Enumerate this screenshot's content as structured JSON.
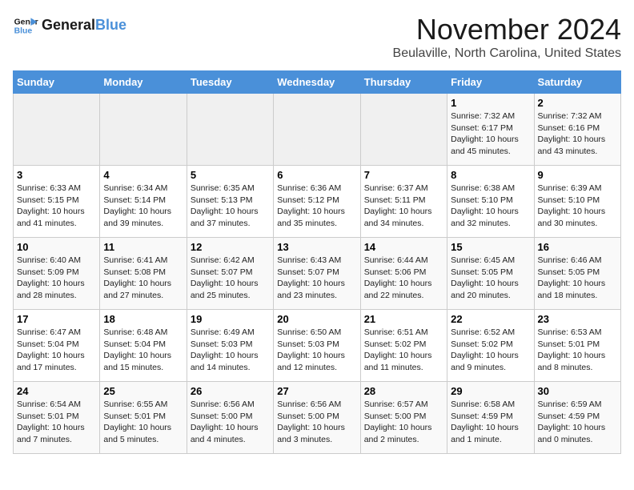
{
  "logo": {
    "line1": "General",
    "line2": "Blue"
  },
  "title": "November 2024",
  "location": "Beulaville, North Carolina, United States",
  "headers": [
    "Sunday",
    "Monday",
    "Tuesday",
    "Wednesday",
    "Thursday",
    "Friday",
    "Saturday"
  ],
  "weeks": [
    [
      {
        "day": "",
        "info": ""
      },
      {
        "day": "",
        "info": ""
      },
      {
        "day": "",
        "info": ""
      },
      {
        "day": "",
        "info": ""
      },
      {
        "day": "",
        "info": ""
      },
      {
        "day": "1",
        "info": "Sunrise: 7:32 AM\nSunset: 6:17 PM\nDaylight: 10 hours\nand 45 minutes."
      },
      {
        "day": "2",
        "info": "Sunrise: 7:32 AM\nSunset: 6:16 PM\nDaylight: 10 hours\nand 43 minutes."
      }
    ],
    [
      {
        "day": "3",
        "info": "Sunrise: 6:33 AM\nSunset: 5:15 PM\nDaylight: 10 hours\nand 41 minutes."
      },
      {
        "day": "4",
        "info": "Sunrise: 6:34 AM\nSunset: 5:14 PM\nDaylight: 10 hours\nand 39 minutes."
      },
      {
        "day": "5",
        "info": "Sunrise: 6:35 AM\nSunset: 5:13 PM\nDaylight: 10 hours\nand 37 minutes."
      },
      {
        "day": "6",
        "info": "Sunrise: 6:36 AM\nSunset: 5:12 PM\nDaylight: 10 hours\nand 35 minutes."
      },
      {
        "day": "7",
        "info": "Sunrise: 6:37 AM\nSunset: 5:11 PM\nDaylight: 10 hours\nand 34 minutes."
      },
      {
        "day": "8",
        "info": "Sunrise: 6:38 AM\nSunset: 5:10 PM\nDaylight: 10 hours\nand 32 minutes."
      },
      {
        "day": "9",
        "info": "Sunrise: 6:39 AM\nSunset: 5:10 PM\nDaylight: 10 hours\nand 30 minutes."
      }
    ],
    [
      {
        "day": "10",
        "info": "Sunrise: 6:40 AM\nSunset: 5:09 PM\nDaylight: 10 hours\nand 28 minutes."
      },
      {
        "day": "11",
        "info": "Sunrise: 6:41 AM\nSunset: 5:08 PM\nDaylight: 10 hours\nand 27 minutes."
      },
      {
        "day": "12",
        "info": "Sunrise: 6:42 AM\nSunset: 5:07 PM\nDaylight: 10 hours\nand 25 minutes."
      },
      {
        "day": "13",
        "info": "Sunrise: 6:43 AM\nSunset: 5:07 PM\nDaylight: 10 hours\nand 23 minutes."
      },
      {
        "day": "14",
        "info": "Sunrise: 6:44 AM\nSunset: 5:06 PM\nDaylight: 10 hours\nand 22 minutes."
      },
      {
        "day": "15",
        "info": "Sunrise: 6:45 AM\nSunset: 5:05 PM\nDaylight: 10 hours\nand 20 minutes."
      },
      {
        "day": "16",
        "info": "Sunrise: 6:46 AM\nSunset: 5:05 PM\nDaylight: 10 hours\nand 18 minutes."
      }
    ],
    [
      {
        "day": "17",
        "info": "Sunrise: 6:47 AM\nSunset: 5:04 PM\nDaylight: 10 hours\nand 17 minutes."
      },
      {
        "day": "18",
        "info": "Sunrise: 6:48 AM\nSunset: 5:04 PM\nDaylight: 10 hours\nand 15 minutes."
      },
      {
        "day": "19",
        "info": "Sunrise: 6:49 AM\nSunset: 5:03 PM\nDaylight: 10 hours\nand 14 minutes."
      },
      {
        "day": "20",
        "info": "Sunrise: 6:50 AM\nSunset: 5:03 PM\nDaylight: 10 hours\nand 12 minutes."
      },
      {
        "day": "21",
        "info": "Sunrise: 6:51 AM\nSunset: 5:02 PM\nDaylight: 10 hours\nand 11 minutes."
      },
      {
        "day": "22",
        "info": "Sunrise: 6:52 AM\nSunset: 5:02 PM\nDaylight: 10 hours\nand 9 minutes."
      },
      {
        "day": "23",
        "info": "Sunrise: 6:53 AM\nSunset: 5:01 PM\nDaylight: 10 hours\nand 8 minutes."
      }
    ],
    [
      {
        "day": "24",
        "info": "Sunrise: 6:54 AM\nSunset: 5:01 PM\nDaylight: 10 hours\nand 7 minutes."
      },
      {
        "day": "25",
        "info": "Sunrise: 6:55 AM\nSunset: 5:01 PM\nDaylight: 10 hours\nand 5 minutes."
      },
      {
        "day": "26",
        "info": "Sunrise: 6:56 AM\nSunset: 5:00 PM\nDaylight: 10 hours\nand 4 minutes."
      },
      {
        "day": "27",
        "info": "Sunrise: 6:56 AM\nSunset: 5:00 PM\nDaylight: 10 hours\nand 3 minutes."
      },
      {
        "day": "28",
        "info": "Sunrise: 6:57 AM\nSunset: 5:00 PM\nDaylight: 10 hours\nand 2 minutes."
      },
      {
        "day": "29",
        "info": "Sunrise: 6:58 AM\nSunset: 4:59 PM\nDaylight: 10 hours\nand 1 minute."
      },
      {
        "day": "30",
        "info": "Sunrise: 6:59 AM\nSunset: 4:59 PM\nDaylight: 10 hours\nand 0 minutes."
      }
    ]
  ]
}
